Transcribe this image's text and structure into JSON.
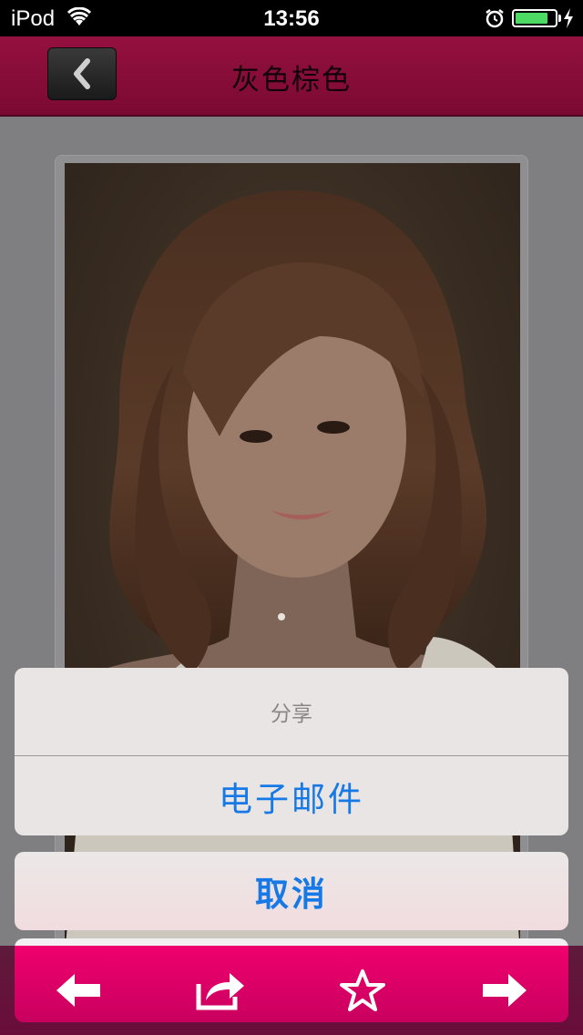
{
  "status_bar": {
    "carrier": "iPod",
    "time": "13:56",
    "battery_level": 0.85
  },
  "nav": {
    "title": "灰色棕色",
    "back_icon": "chevron-left-icon"
  },
  "action_sheet": {
    "title": "分享",
    "options": [
      "电子邮件"
    ],
    "cancel": "取消"
  },
  "toolbar": {
    "items": [
      {
        "name": "previous",
        "icon": "arrow-left-icon"
      },
      {
        "name": "share",
        "icon": "share-icon"
      },
      {
        "name": "favorite",
        "icon": "star-icon"
      },
      {
        "name": "next",
        "icon": "arrow-right-icon"
      }
    ]
  },
  "colors": {
    "nav_bar": "#8a0d3a",
    "toolbar": "#e8006a",
    "action_text": "#1679e6"
  }
}
